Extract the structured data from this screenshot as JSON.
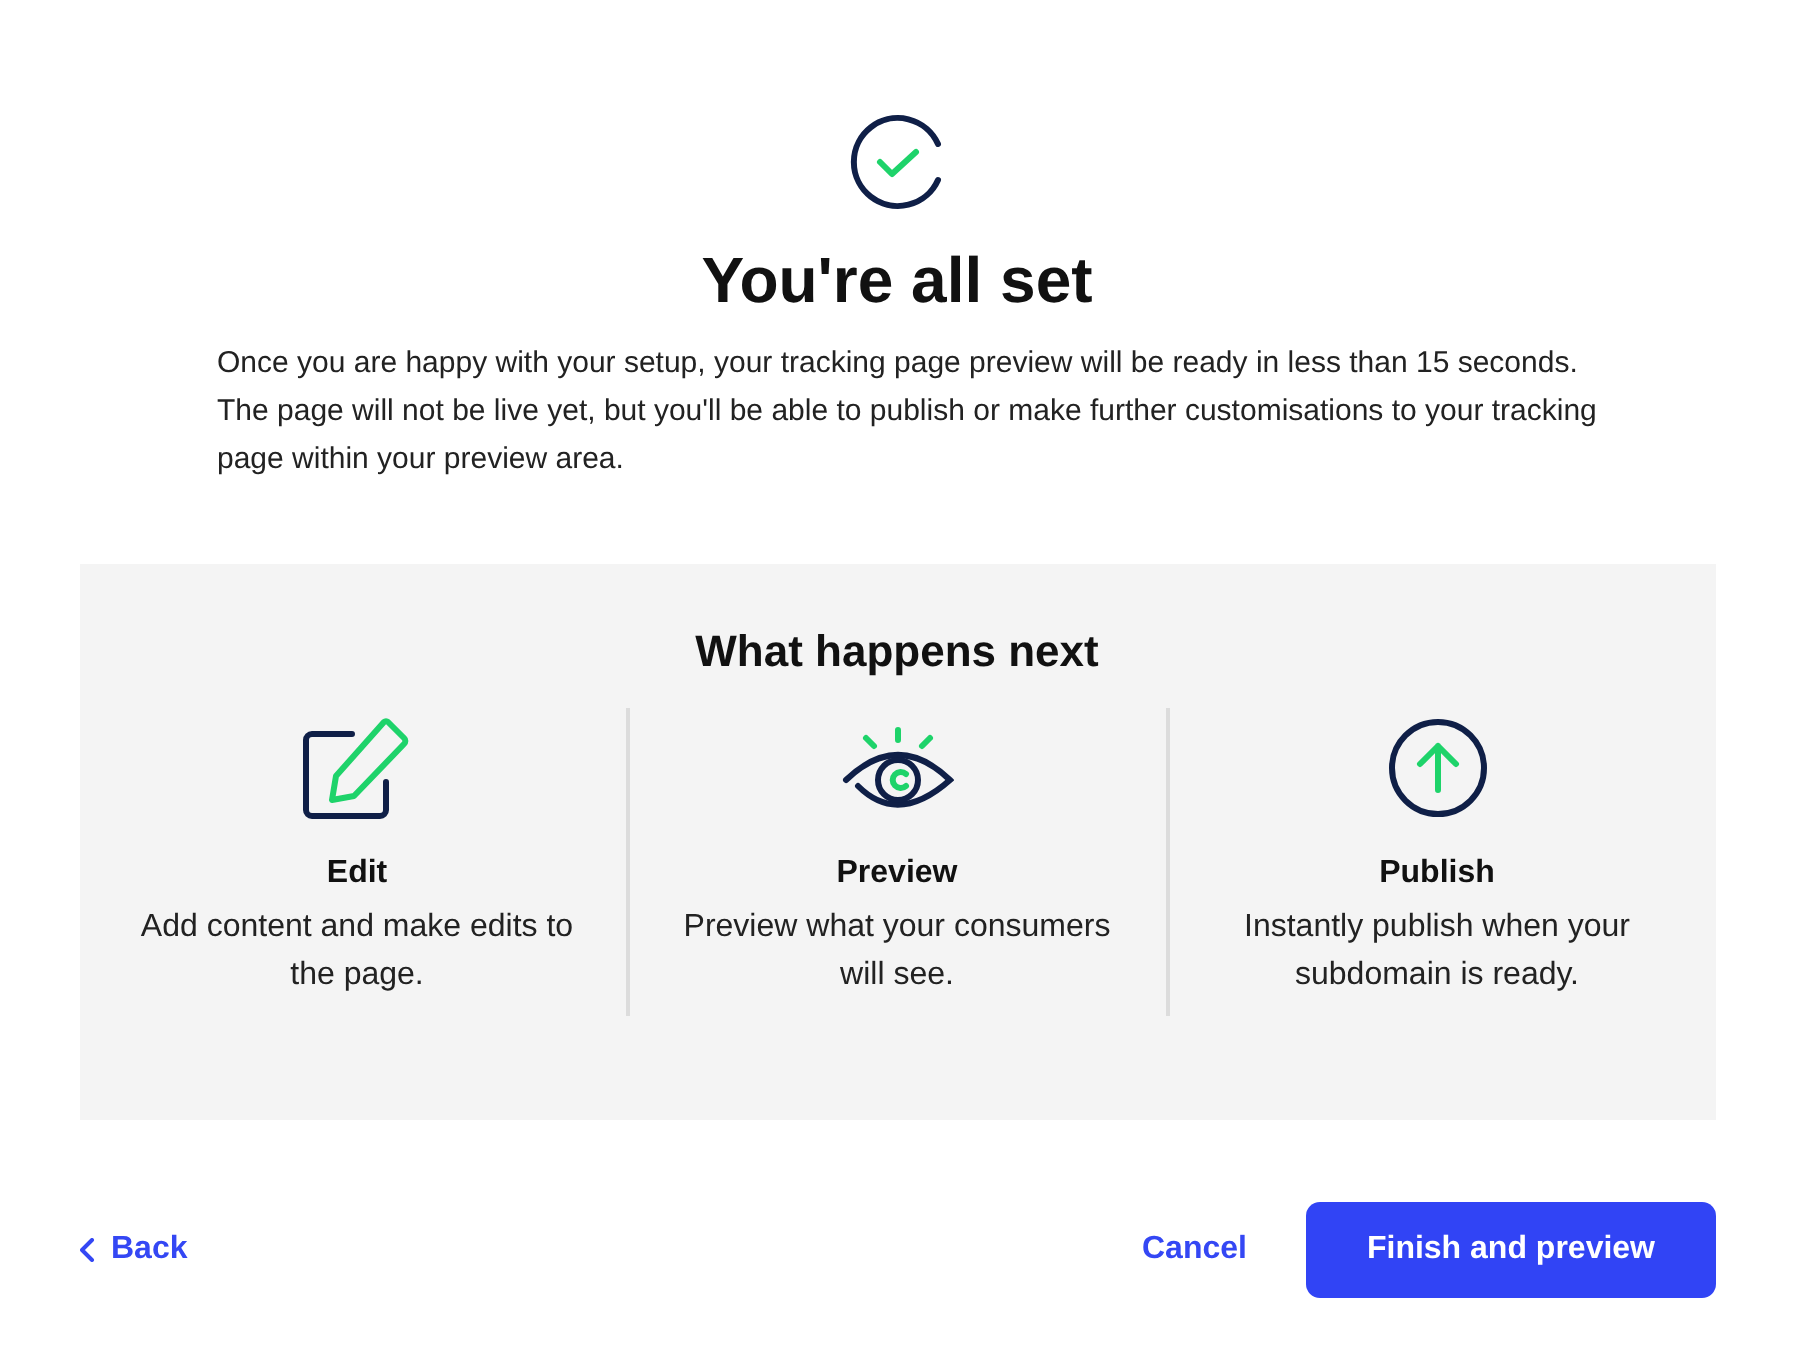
{
  "title": "You're all set",
  "description": "Once you are happy with your setup, your tracking page preview will be ready in less than 15 seconds. The page will not be live yet, but you'll be able to publish or make further customisations to your tracking page within your preview area.",
  "next": {
    "heading": "What happens next",
    "steps": [
      {
        "kind": "edit",
        "title": "Edit",
        "text": "Add content and make edits to the page."
      },
      {
        "kind": "preview",
        "title": "Preview",
        "text": "Preview what your consumers will see."
      },
      {
        "kind": "publish",
        "title": "Publish",
        "text": "Instantly publish when your subdomain is ready."
      }
    ]
  },
  "footer": {
    "back": "Back",
    "cancel": "Cancel",
    "primary": "Finish and preview"
  }
}
